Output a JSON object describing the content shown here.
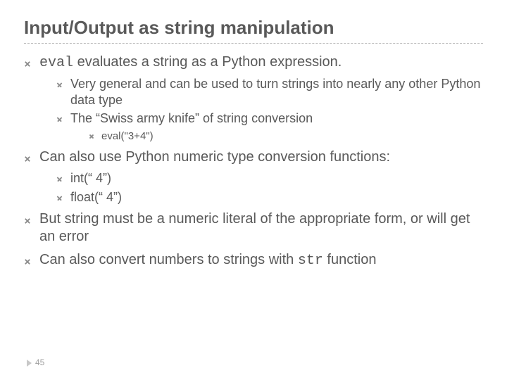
{
  "title": "Input/Output as string manipulation",
  "items": {
    "b1_pre": "eval",
    "b1_post": " evaluates a string as a Python expression.",
    "b1_sub1": "Very general and can be used to turn strings into nearly any other Python data type",
    "b1_sub2": "The “Swiss army knife” of string conversion",
    "b1_sub2_code": "eval(\"3+4\")",
    "b2": "Can also use Python numeric type conversion functions:",
    "b2_sub1": "int(“ 4”)",
    "b2_sub2": "float(“ 4”)",
    "b3": "But string must be a numeric literal of the appropriate form, or will get an error",
    "b4_pre": "Can also convert numbers to strings with ",
    "b4_code": "str",
    "b4_post": " function"
  },
  "page": "45"
}
